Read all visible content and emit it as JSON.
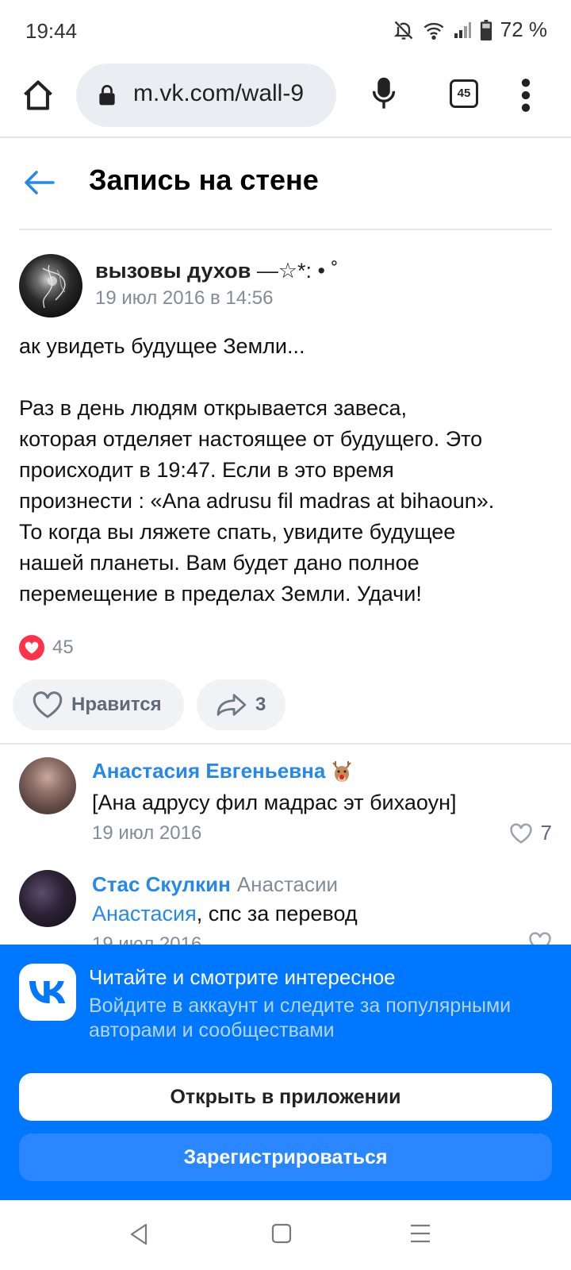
{
  "status_bar": {
    "time": "19:44",
    "battery": "72 %"
  },
  "browser": {
    "url": "m.vk.com/wall-9",
    "tab_count": "45"
  },
  "header": {
    "title": "Запись на стене"
  },
  "post": {
    "author": "вызовы духов",
    "author_deco": " —☆*: • ˚",
    "date": "19 июл 2016 в 14:56",
    "lines": [
      "ак увидеть будущее Земли...",
      "",
      "Раз в день людям открывается завеса,",
      "которая отделяет настоящее от будущего. Это",
      "происходит в 19:47. Если в это время",
      "произнести : «Ana adrusu fil madras at bihaoun».",
      "То когда вы ляжете спать, увидите будущее",
      "нашей планеты. Вам будет дано полное",
      "перемещение в пределах Земли. Удачи!"
    ],
    "reaction_count": "45",
    "like_label": "Нравится",
    "share_count": "3"
  },
  "comments": [
    {
      "name": "Анастасия Евгеньевна",
      "text": "[Ана адрусу фил мадрас эт бихаоун]",
      "date": "19 июл 2016",
      "likes": "7"
    },
    {
      "name": "Стас Скулкин",
      "reply_to": "Анастасии",
      "mention": "Анастасия",
      "text": ", спс за перевод",
      "date": "19 июл 2016",
      "likes": ""
    }
  ],
  "promo": {
    "title": "Читайте и смотрите интересное",
    "subtitle": "Войдите в аккаунт и следите за популярными авторами и сообществами",
    "open_app": "Открыть в приложении",
    "register": "Зарегистрироваться"
  },
  "colors": {
    "vk_blue": "#0077ff",
    "link": "#2688eb",
    "reaction_red": "#ff3347"
  }
}
